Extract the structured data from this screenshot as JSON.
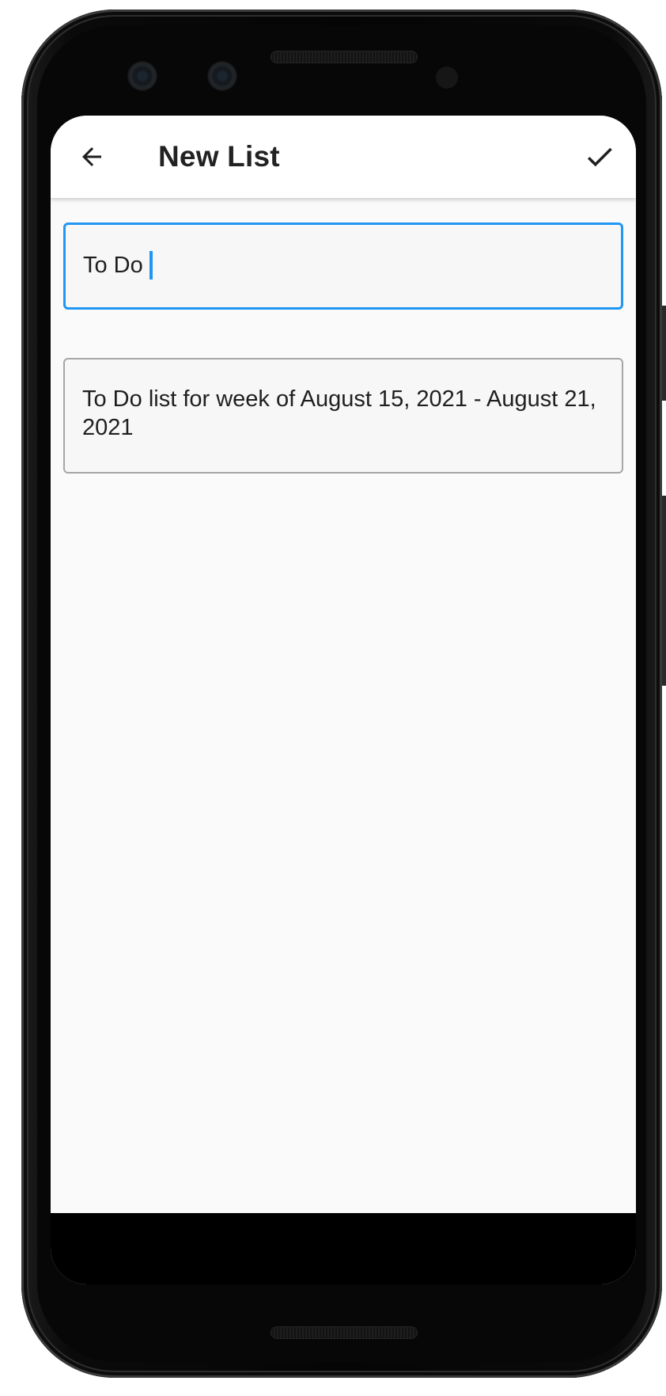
{
  "device": {
    "frame_color": "#070707"
  },
  "app_bar": {
    "title": "New List",
    "back_icon": "arrow-left-icon",
    "save_icon": "check-icon"
  },
  "form": {
    "name_field": {
      "value": "To Do",
      "focused": true,
      "border_color": "#2196f3"
    },
    "description_field": {
      "value": "To Do list for week of August 15, 2021 - August 21, 2021",
      "border_color": "#a6a6a6"
    }
  },
  "colors": {
    "screen_background": "#fafafa",
    "app_bar_background": "#ffffff",
    "accent": "#2196f3",
    "text": "#222222",
    "navigation_bar": "#000000"
  }
}
